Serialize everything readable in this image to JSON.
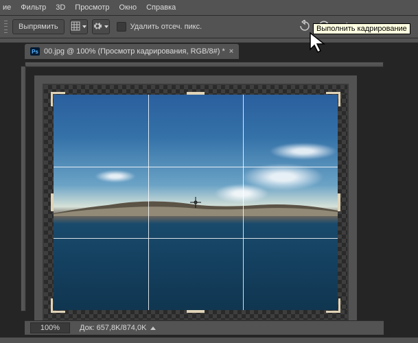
{
  "menu": {
    "items": [
      "ие",
      "Фильтр",
      "3D",
      "Просмотр",
      "Окно",
      "Справка"
    ]
  },
  "options": {
    "straighten_label": "Выпрямить",
    "delete_pixels_label": "Удалить отсеч. пикс.",
    "icons": {
      "grid": "grid-icon",
      "gear": "gear-icon",
      "reset": "reset-icon",
      "cancel": "cancel-icon",
      "commit": "commit-icon"
    }
  },
  "tab": {
    "title": "00.jpg @ 100% (Просмотр кадрирования, RGB/8#) *"
  },
  "status": {
    "zoom": "100%",
    "doc": "Док: 657,8K/874,0K"
  },
  "tooltip": "Выполнить кадрирование"
}
